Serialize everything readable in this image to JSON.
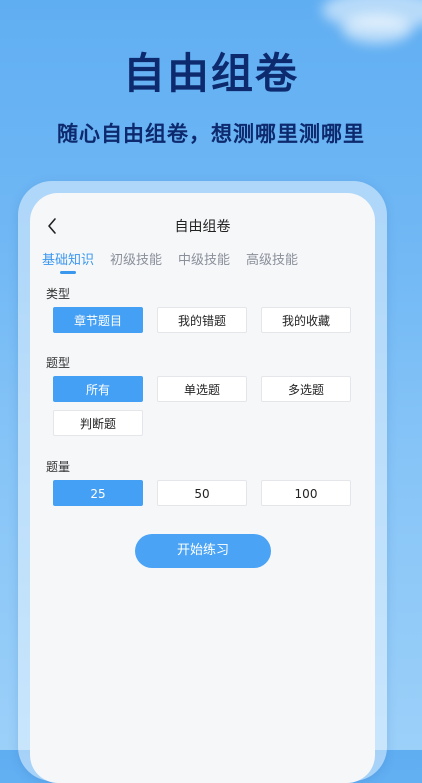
{
  "hero": {
    "title": "自由组卷",
    "subtitle": "随心自由组卷，想测哪里测哪里"
  },
  "nav": {
    "back_icon": "chevron-left-icon",
    "title": "自由组卷"
  },
  "tabs": [
    {
      "label": "基础知识",
      "active": true
    },
    {
      "label": "初级技能",
      "active": false
    },
    {
      "label": "中级技能",
      "active": false
    },
    {
      "label": "高级技能",
      "active": false
    }
  ],
  "sections": {
    "category": {
      "label": "类型",
      "options": [
        "章节题目",
        "我的错题",
        "我的收藏"
      ],
      "selected": "章节题目"
    },
    "question_type": {
      "label": "题型",
      "options": [
        "所有",
        "单选题",
        "多选题",
        "判断题"
      ],
      "selected": "所有"
    },
    "quantity": {
      "label": "题量",
      "options": [
        "25",
        "50",
        "100"
      ],
      "selected": "25"
    }
  },
  "start_button": "开始练习",
  "colors": {
    "accent": "#3a97ee",
    "hero_text": "#0e2a6e",
    "background_top": "#60aef2"
  }
}
